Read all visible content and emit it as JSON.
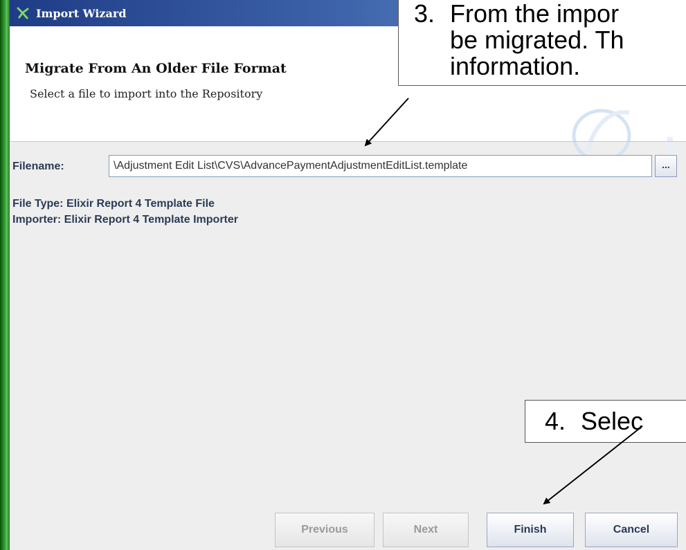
{
  "window": {
    "title": "Import Wizard"
  },
  "header": {
    "heading": "Migrate From An Older File Format",
    "subheading": "Select a file to import into the Repository"
  },
  "form": {
    "filename_label": "Filename:",
    "filename_value": "\\Adjustment Edit List\\CVS\\AdvancePaymentAdjustmentEditList.template",
    "browse_label": "...",
    "file_type": "File Type: Elixir Report 4 Template File",
    "importer": "Importer: Elixir Report 4 Template Importer"
  },
  "buttons": {
    "previous": "Previous",
    "next": "Next",
    "finish": "Finish",
    "cancel": "Cancel"
  },
  "callouts": {
    "step3": {
      "number": "3.",
      "line1": "From the impor",
      "line2": "be migrated. Th",
      "line3": "information."
    },
    "step4": {
      "number": "4.",
      "text": "Selec"
    }
  },
  "colors": {
    "titlebar_start": "#1f3c86",
    "titlebar_end": "#7a9bd0",
    "label_text": "#2b3b55",
    "background": "#eeeeee",
    "desktop_green": "#1f7d1f"
  },
  "icons": {
    "title": "wizard-icon",
    "header_decoration": "swoosh-logo"
  }
}
